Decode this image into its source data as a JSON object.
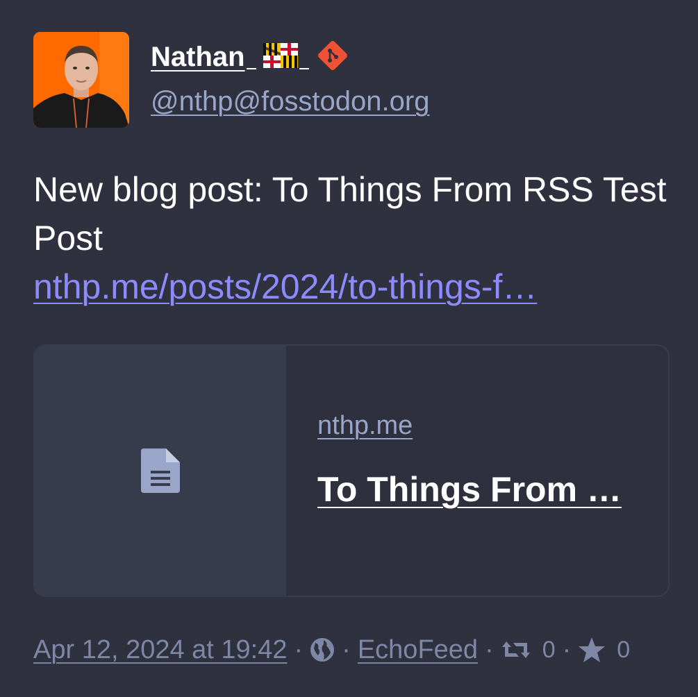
{
  "author": {
    "display_name": "Nathan",
    "handle": "@nthp@fosstodon.org",
    "avatar_icon": "person-avatar",
    "emojis": [
      "maryland-flag-icon",
      "git-icon"
    ]
  },
  "post": {
    "text": "New blog post: To Things From RSS Test Post",
    "link_text": "nthp.me/posts/2024/to-things-f…"
  },
  "preview": {
    "icon": "document-icon",
    "domain": "nthp.me",
    "title": "To Things From …"
  },
  "footer": {
    "timestamp": "Apr 12, 2024 at 19:42",
    "visibility_icon": "globe-icon",
    "client": "EchoFeed",
    "boost_count": "0",
    "favourite_count": "0",
    "separator": "·"
  },
  "colors": {
    "background": "#30313f",
    "link": "#8c8cff",
    "muted": "#7e87a6",
    "git_orange": "#f05133"
  }
}
